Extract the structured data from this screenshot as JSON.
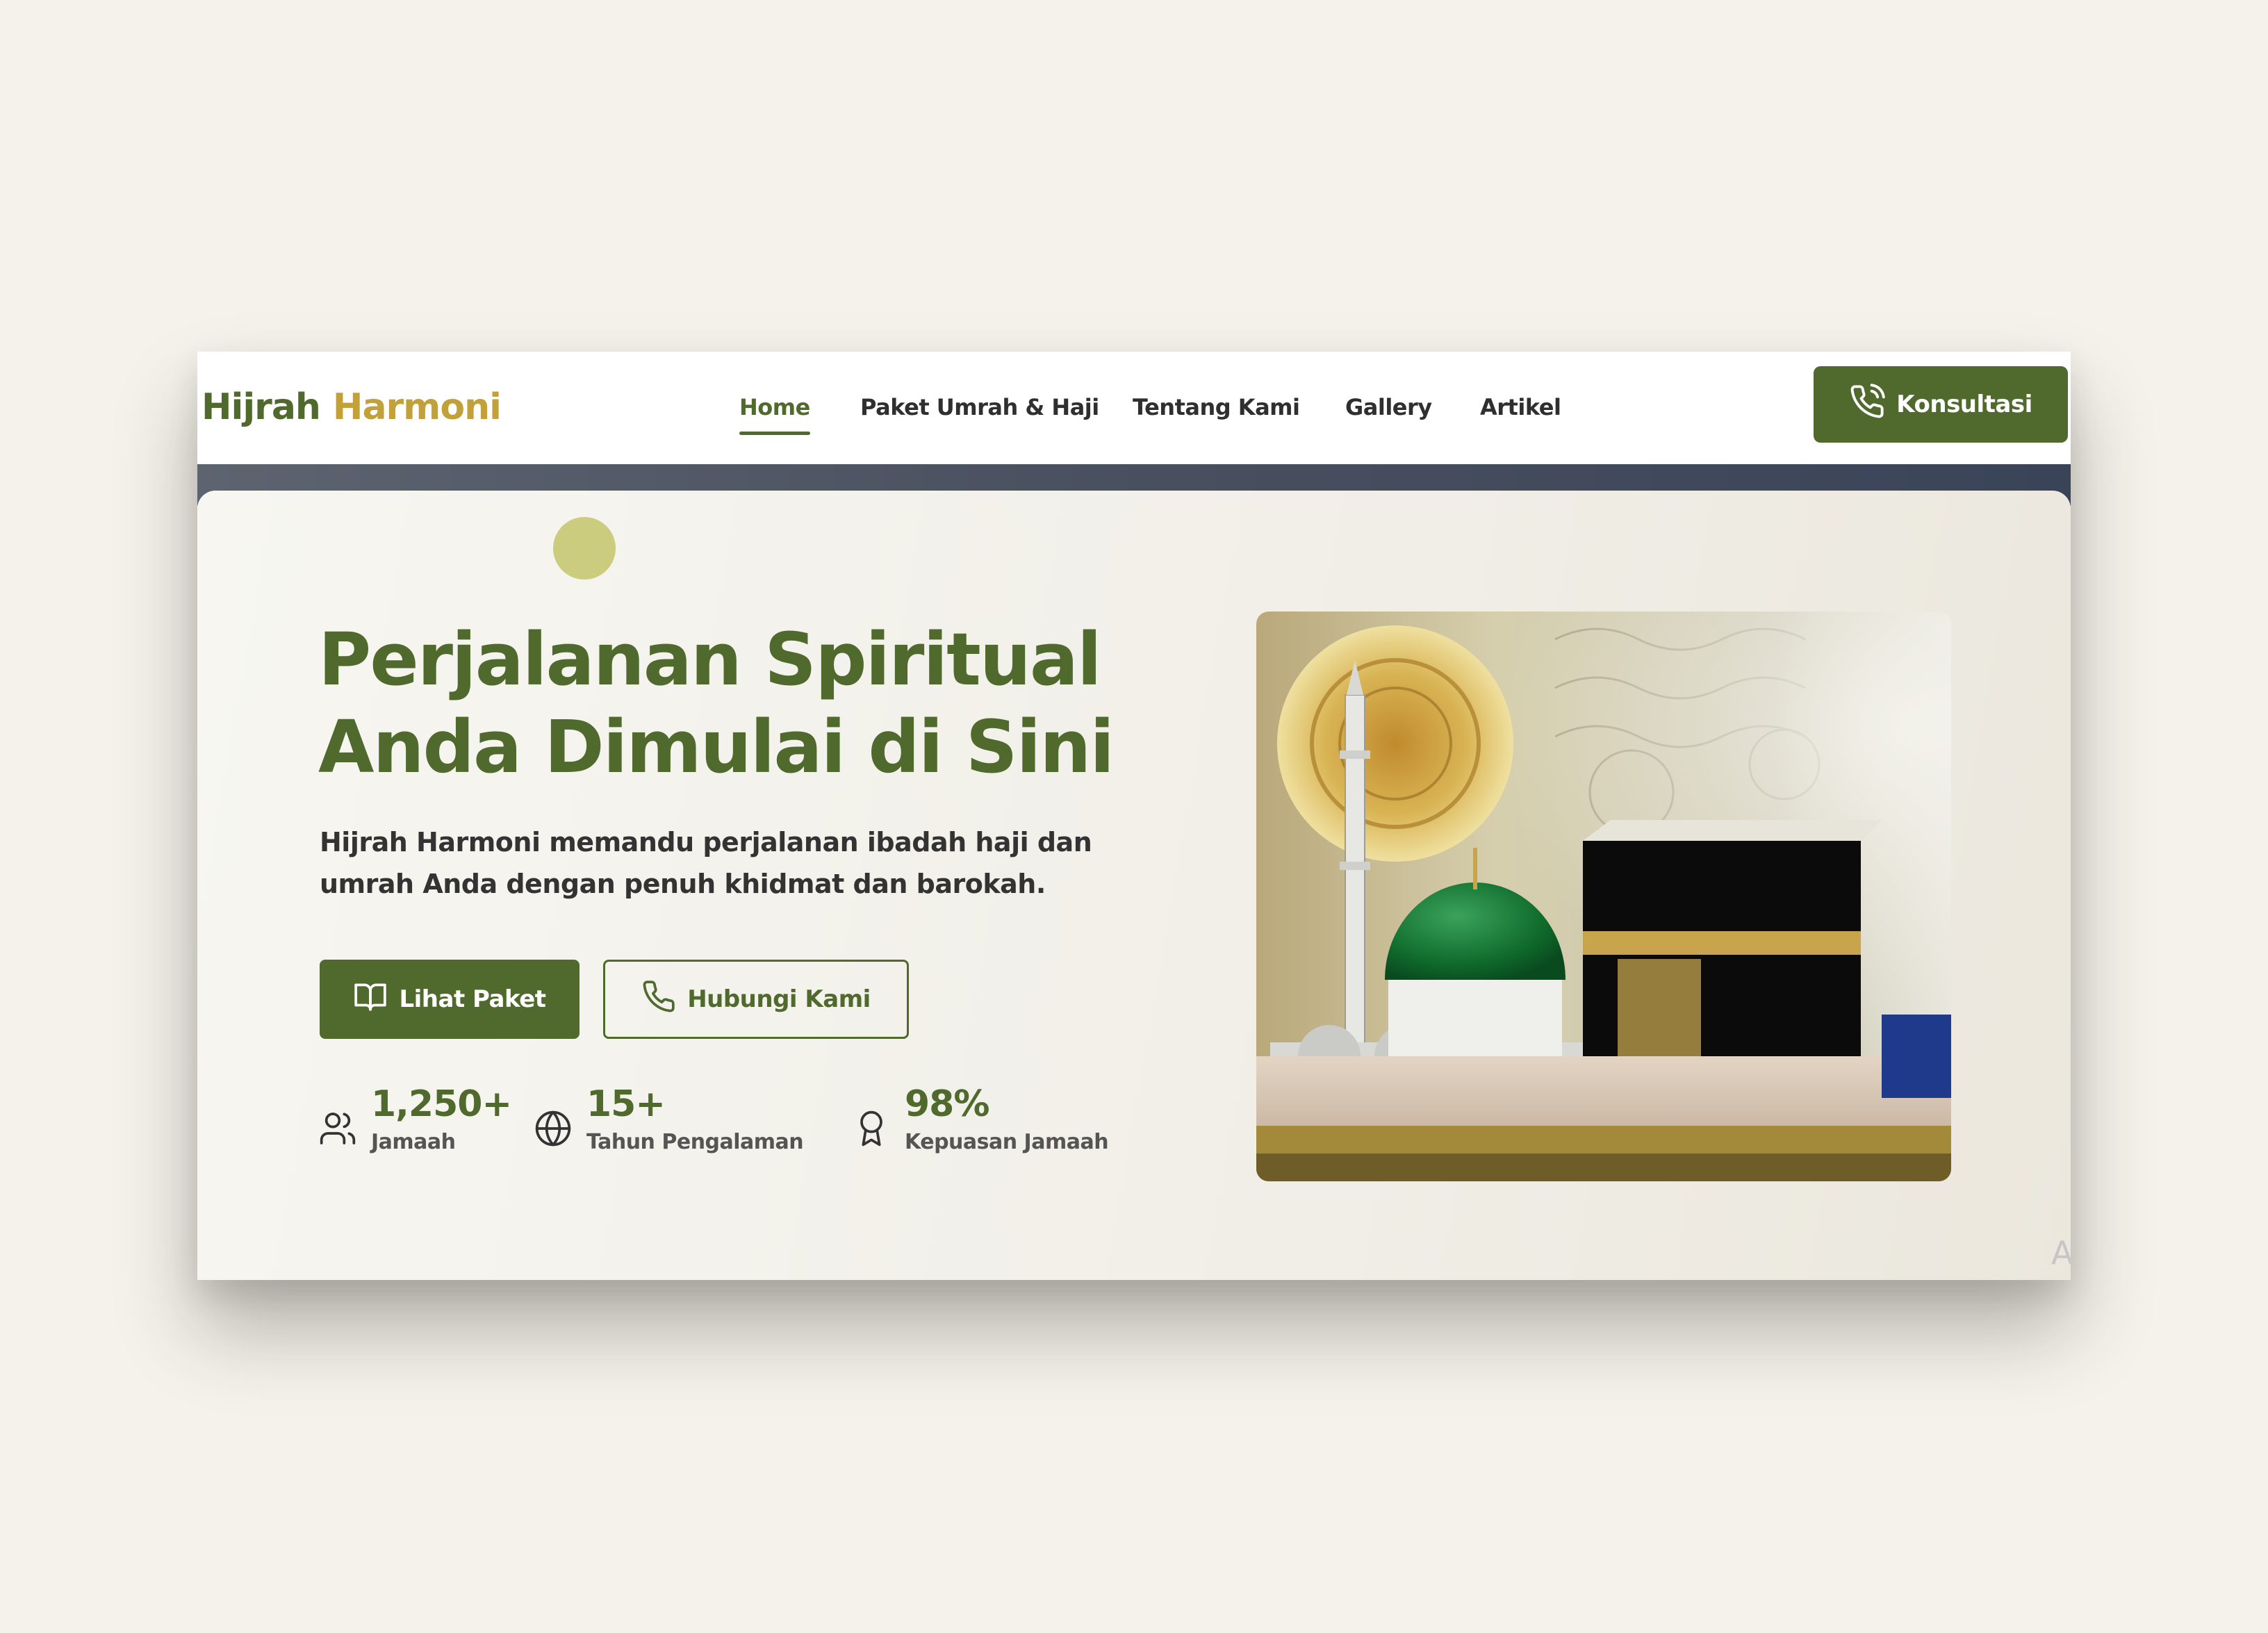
{
  "brand": {
    "name_part1": "Hijrah",
    "name_part2": "Harmoni",
    "primary_color": "#4f6a2c",
    "accent_color": "#c2a03a"
  },
  "nav": {
    "items": [
      {
        "label": "Home",
        "active": true
      },
      {
        "label": "Paket Umrah & Haji",
        "active": false
      },
      {
        "label": "Tentang Kami",
        "active": false
      },
      {
        "label": "Gallery",
        "active": false
      },
      {
        "label": "Artikel",
        "active": false
      }
    ],
    "cta_label": "Konsultasi",
    "cta_icon": "phone-call-icon"
  },
  "hero": {
    "headline_line1": "Perjalanan Spiritual",
    "headline_line2": "Anda Dimulai di Sini",
    "subtitle_line1": "Hijrah Harmoni memandu perjalanan ibadah haji dan",
    "subtitle_line2": "umrah Anda dengan penuh khidmat dan barokah.",
    "primary_button": {
      "label": "Lihat Paket",
      "icon": "book-open-icon"
    },
    "secondary_button": {
      "label": "Hubungi Kami",
      "icon": "phone-icon"
    },
    "image_subject": "Masjid Nabawi green dome and minaret beside the Kaaba with pilgrims"
  },
  "stats": [
    {
      "value": "1,250+",
      "label": "Jamaah",
      "icon": "users-icon"
    },
    {
      "value": "15+",
      "label": "Tahun Pengalaman",
      "icon": "globe-icon"
    },
    {
      "value": "98%",
      "label": "Kepuasan Jamaah",
      "icon": "award-icon"
    }
  ],
  "corner_text": "A"
}
